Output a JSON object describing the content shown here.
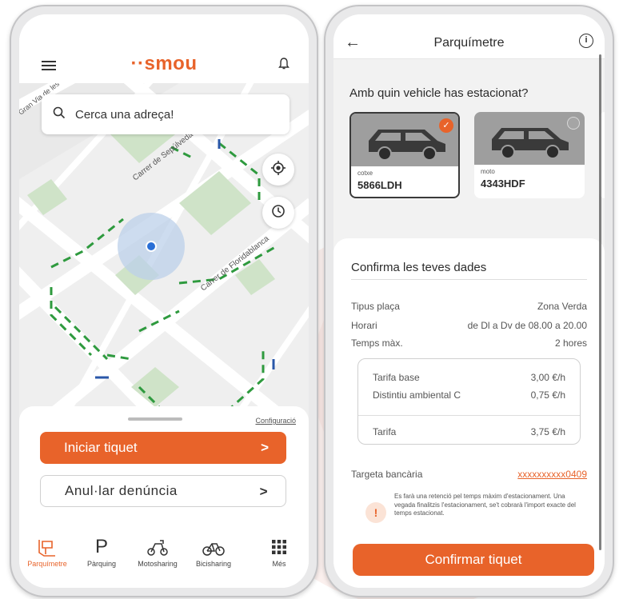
{
  "smou_app": {
    "logo_text": "··smou",
    "search_placeholder": "Cerca una adreça!",
    "map": {
      "street_labels": [
        "Carrer de Sepúlveda",
        "Carrer de Floridablanca",
        "Gran Via de les"
      ]
    },
    "settings_link": "Configuració",
    "start_ticket_button": "Iniciar tiquet",
    "cancel_fine_button": "Anul·lar denúncia",
    "tabs": [
      {
        "label": "Parquímetre",
        "icon": "parking-meter-icon",
        "active": true
      },
      {
        "label": "Pàrquing",
        "icon": "parking-p-icon",
        "active": false
      },
      {
        "label": "Motosharing",
        "icon": "scooter-icon",
        "active": false
      },
      {
        "label": "Bicisharing",
        "icon": "bicycle-icon",
        "active": false
      },
      {
        "label": "Més",
        "icon": "grid-icon",
        "active": false
      }
    ]
  },
  "parquimetre": {
    "title": "Parquímetre",
    "question": "Amb quin vehicle has estacionat?",
    "vehicles": [
      {
        "type": "cotxe",
        "plate": "5866LDH",
        "selected": true
      },
      {
        "type": "moto",
        "plate": "4343HDF",
        "selected": false
      }
    ],
    "confirm_section_title": "Confirma les teves dades",
    "details": [
      {
        "label": "Tipus plaça",
        "value": "Zona Verda"
      },
      {
        "label": "Horari",
        "value": "de Dl a Dv de 08.00 a 20.00"
      },
      {
        "label": "Temps màx.",
        "value": "2 hores"
      }
    ],
    "tariffs": [
      {
        "label": "Tarifa base",
        "value": "3,00 €/h"
      },
      {
        "label": "Distintiu ambiental C",
        "value": "0,75 €/h"
      }
    ],
    "total_tariff": {
      "label": "Tarifa",
      "value": "3,75 €/h"
    },
    "card": {
      "label": "Targeta bancària",
      "value": "xxxxxxxxxx0409"
    },
    "warning_text": "Es farà una retenció pel temps màxim d'estacionament. Una vegada finalitzis l'estacionament, se't cobrarà l'import exacte del temps estacionat.",
    "confirm_button": "Confirmar tiquet"
  },
  "colors": {
    "brand_orange": "#e8632a",
    "zone_green": "#2e9a3e",
    "zone_blue": "#2a57a8"
  }
}
